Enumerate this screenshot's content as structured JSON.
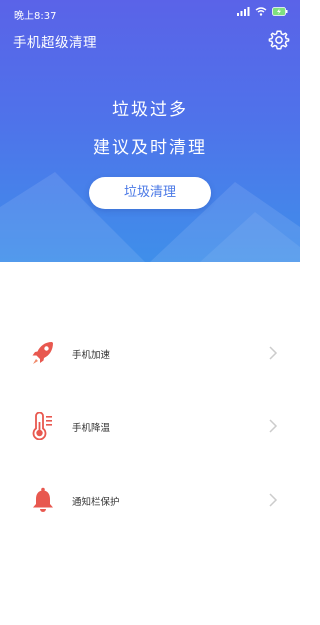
{
  "status_bar": {
    "time": "晚上8:37",
    "icons": [
      "signal-icon",
      "wifi-icon",
      "battery-charging-icon"
    ],
    "battery_color": "#7fe07f"
  },
  "header": {
    "title": "手机超级清理",
    "settings_icon": "gear-icon"
  },
  "hero": {
    "line1": "垃圾过多",
    "line2": "建议及时清理",
    "button_label": "垃圾清理",
    "gradient_top": "#5a63e8",
    "gradient_bottom": "#3f8fea"
  },
  "menu": {
    "items": [
      {
        "label": "手机加速",
        "icon": "rocket-icon",
        "color": "#e8584f"
      },
      {
        "label": "手机降温",
        "icon": "thermometer-icon",
        "color": "#e8584f"
      },
      {
        "label": "通知栏保护",
        "icon": "bell-icon",
        "color": "#e8584f"
      }
    ]
  }
}
